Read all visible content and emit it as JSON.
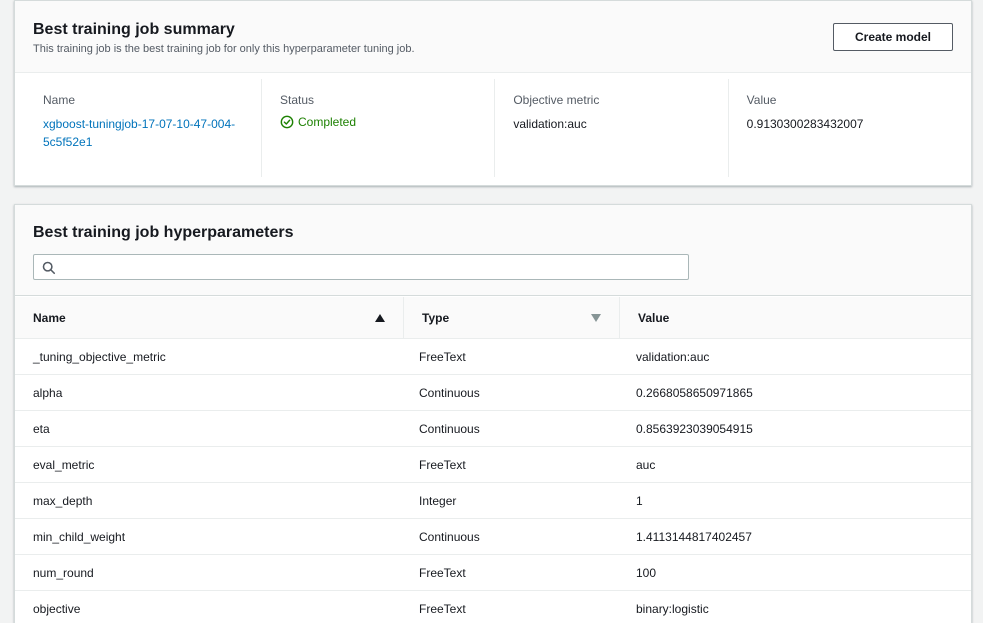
{
  "summary": {
    "title": "Best training job summary",
    "description": "This training job is the best training job for only this hyperparameter tuning job.",
    "create_model_label": "Create model",
    "fields": {
      "name_label": "Name",
      "name_value": "xgboost-tuningjob-17-07-10-47-004-5c5f52e1",
      "status_label": "Status",
      "status_value": "Completed",
      "metric_label": "Objective metric",
      "metric_value": "validation:auc",
      "value_label": "Value",
      "value_value": "0.9130300283432007"
    }
  },
  "hyperparameters": {
    "title": "Best training job hyperparameters",
    "search": {
      "value": "",
      "placeholder": ""
    },
    "columns": [
      "Name",
      "Type",
      "Value"
    ],
    "rows": [
      {
        "name": "_tuning_objective_metric",
        "type": "FreeText",
        "value": "validation:auc"
      },
      {
        "name": "alpha",
        "type": "Continuous",
        "value": "0.2668058650971865"
      },
      {
        "name": "eta",
        "type": "Continuous",
        "value": "0.8563923039054915"
      },
      {
        "name": "eval_metric",
        "type": "FreeText",
        "value": "auc"
      },
      {
        "name": "max_depth",
        "type": "Integer",
        "value": "1"
      },
      {
        "name": "min_child_weight",
        "type": "Continuous",
        "value": "1.4113144817402457"
      },
      {
        "name": "num_round",
        "type": "FreeText",
        "value": "100"
      },
      {
        "name": "objective",
        "type": "FreeText",
        "value": "binary:logistic"
      }
    ]
  },
  "colors": {
    "link": "#0073bb",
    "success": "#1d8102",
    "border": "#d5dbdb"
  },
  "icons": {
    "status": "check-circle-icon",
    "search": "search-icon",
    "sort_asc": "sort-ascending-icon",
    "sort_desc": "sort-descending-icon"
  }
}
